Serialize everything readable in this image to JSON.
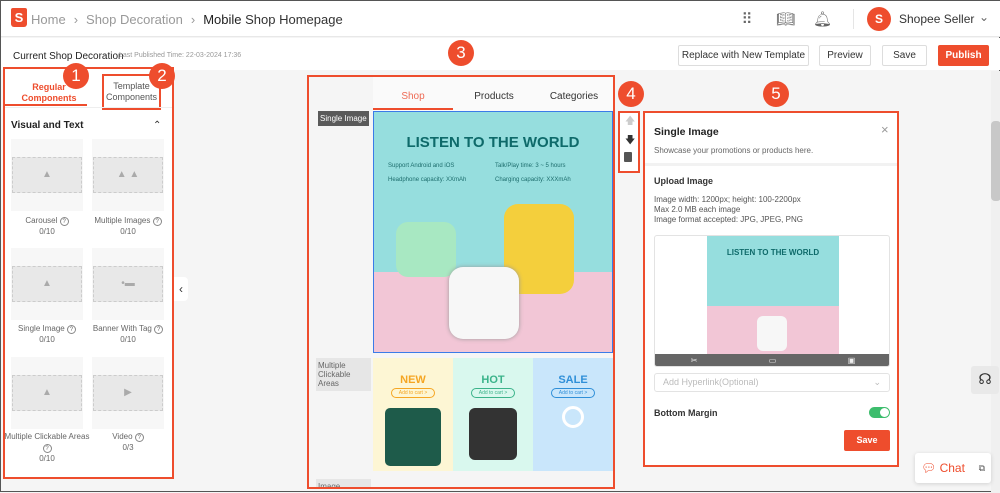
{
  "header": {
    "breadcrumb": [
      "Home",
      "Shop Decoration"
    ],
    "current_bold": "Mobile",
    "current_rest": "Shop Homepage",
    "user": "Shopee Seller",
    "icons": [
      "apps-icon",
      "book-icon",
      "bell-icon"
    ]
  },
  "subbar": {
    "title": "Current Shop Decoration",
    "published": "Last Published Time: 22-03-2024 17:36",
    "replace": "Replace with New Template",
    "preview": "Preview",
    "save": "Save",
    "publish": "Publish"
  },
  "callouts": [
    "1",
    "2",
    "3",
    "4",
    "5"
  ],
  "left": {
    "tab_regular": "Regular Components",
    "tab_template": "Template Components",
    "section": "Visual and Text",
    "tiles": [
      {
        "name": "Carousel",
        "count": "0/10"
      },
      {
        "name": "Multiple Images",
        "count": "0/10"
      },
      {
        "name": "Single Image",
        "count": "0/10"
      },
      {
        "name": "Banner With Tag",
        "count": "0/10"
      },
      {
        "name": "Multiple Clickable Areas",
        "count": "0/10"
      },
      {
        "name": "Video",
        "count": "0/3"
      }
    ]
  },
  "preview": {
    "tabs": [
      "Shop",
      "Products",
      "Categories"
    ],
    "label_single": "Single Image",
    "label_multi": "Multiple Clickable Areas",
    "label_next": "Image",
    "banner": {
      "title": "LISTEN TO THE WORLD",
      "features": [
        "Support Android and iOS",
        "Talk/Play time: 3 ~ 5 hours",
        "Headphone capacity: XXmAh",
        "Charging capacity: XXXmAh"
      ]
    },
    "panels": [
      {
        "title": "NEW",
        "cta": "Add to cart >",
        "color": "#f5a623",
        "bg": "#fdf6d4"
      },
      {
        "title": "HOT",
        "cta": "Add to cart >",
        "color": "#3bb38a",
        "bg": "#d9f8ee"
      },
      {
        "title": "SALE",
        "cta": "Add to cart >",
        "color": "#2f8fd8",
        "bg": "#c9e6fb"
      }
    ]
  },
  "settings": {
    "title": "Single Image",
    "desc": "Showcase your promotions or products here.",
    "upload": "Upload Image",
    "rules": [
      "Image width: 1200px; height: 100-2200px",
      "Max 2.0 MB each image",
      "Image format accepted: JPG, JPEG, PNG"
    ],
    "thumb_title": "LISTEN TO THE WORLD",
    "hyperlink_placeholder": "Add Hyperlink(Optional)",
    "bottom_margin": "Bottom Margin",
    "bottom_margin_on": true,
    "save": "Save"
  },
  "chat": {
    "label": "Chat"
  }
}
